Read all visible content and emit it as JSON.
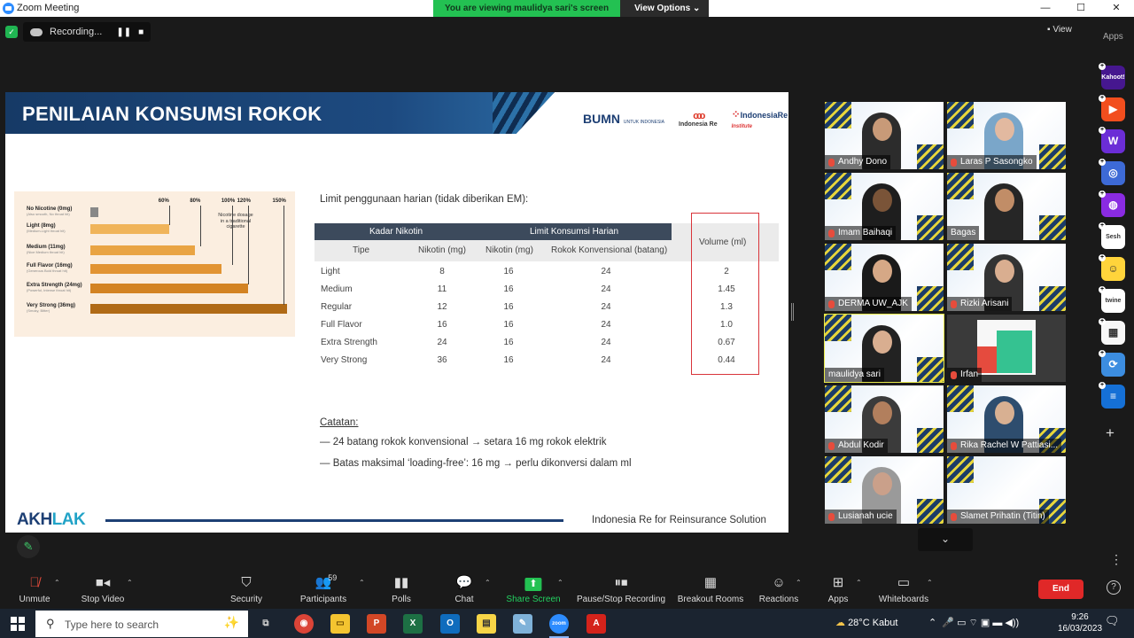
{
  "window": {
    "title": "Zoom Meeting",
    "share_banner": "You are viewing maulidya sari's screen",
    "view_options": "View Options",
    "min": "—",
    "max": "☐",
    "close": "✕"
  },
  "recording": {
    "label": "Recording...",
    "pause": "❚❚",
    "stop": "■"
  },
  "view_label": "View",
  "apps_label": "Apps",
  "slide": {
    "title": "PENILAIAN KONSUMSI ROKOK",
    "logos": {
      "bumn": "BUMN",
      "bumn_sub": "UNTUK INDONESIA",
      "re": "Indonesia Re",
      "re2": "IndonesiaRe",
      "re2_sub": "Institute"
    },
    "infographic": {
      "rows": [
        {
          "label": "No Nicotine (0mg)",
          "sub": "(Also smooth, No throat hit)",
          "pct": 0.03
        },
        {
          "label": "Light (8mg)",
          "sub": "(Medium-Light throat hit)",
          "pct": 0.6
        },
        {
          "label": "Medium (11mg)",
          "sub": "(Nice Medium throat hit)",
          "pct": 0.8
        },
        {
          "label": "Full Flavor (16mg)",
          "sub": "(Generous Bold throat hit)",
          "pct": 1.0
        },
        {
          "label": "Extra Strength (24mg)",
          "sub": "(Powerful, Intense throat hit)",
          "pct": 1.2
        },
        {
          "label": "Very Strong (36mg)",
          "sub": "(Smoky, Bitter)",
          "pct": 1.5
        }
      ],
      "ticks": [
        "60%",
        "80%",
        "100%",
        "120%",
        "150%"
      ],
      "note": "Nicotine dosage in a traditional cigarette"
    },
    "limit_text": "Limit penggunaan harian (tidak diberikan EM):",
    "table": {
      "group_kadar": "Kadar Nikotin",
      "group_limit": "Limit Konsumsi Harian",
      "volume_header": "Volume (ml)",
      "col_tipe": "Tipe",
      "col_nikotin": "Nikotin (mg)",
      "col_nikotin2": "Nikotin (mg)",
      "col_rokok": "Rokok Konvensional (batang)",
      "rows": [
        {
          "tipe": "Light",
          "nik": "8",
          "nik2": "16",
          "rokok": "24",
          "vol": "2"
        },
        {
          "tipe": "Medium",
          "nik": "11",
          "nik2": "16",
          "rokok": "24",
          "vol": "1.45"
        },
        {
          "tipe": "Regular",
          "nik": "12",
          "nik2": "16",
          "rokok": "24",
          "vol": "1.3"
        },
        {
          "tipe": "Full Flavor",
          "nik": "16",
          "nik2": "16",
          "rokok": "24",
          "vol": "1.0"
        },
        {
          "tipe": "Extra Strength",
          "nik": "24",
          "nik2": "16",
          "rokok": "24",
          "vol": "0.67"
        },
        {
          "tipe": "Very Strong",
          "nik": "36",
          "nik2": "16",
          "rokok": "24",
          "vol": "0.44"
        }
      ]
    },
    "notes_title": "Catatan:",
    "notes": [
      "— 24 batang rokok konvensional → setara 16 mg rokok elektrik",
      "— Batas maksimal ‘loading-free’: 16 mg → perlu dikonversi dalam ml"
    ],
    "akhlak_a": "AKH",
    "akhlak_b": "LAK",
    "footer": "Indonesia Re for Reinsurance Solution"
  },
  "participants_gallery": [
    {
      "name": "Andhy Dono",
      "muted": true,
      "skin": "#c89a78",
      "shirt": "#2c2c2c"
    },
    {
      "name": "Laras P Sasongko",
      "muted": true,
      "skin": "#e2b9a0",
      "shirt": "#7aa6c9"
    },
    {
      "name": "Imam Baihaqi",
      "muted": true,
      "skin": "#7a5438",
      "shirt": "#1e1e1e"
    },
    {
      "name": "Bagas",
      "muted": false,
      "skin": "#c18d67",
      "shirt": "#262626"
    },
    {
      "name": "DERMA UW_AJK",
      "muted": true,
      "skin": "#d6a886",
      "shirt": "#1a1a1a"
    },
    {
      "name": "Rizki Arisani",
      "muted": true,
      "skin": "#d9ae90",
      "shirt": "#333"
    },
    {
      "name": "maulidya sari",
      "muted": false,
      "skin": "#d9ae90",
      "shirt": "#222"
    },
    {
      "name": "Irfan",
      "muted": true,
      "skin": "",
      "shirt": ""
    },
    {
      "name": "Abdul Kodir",
      "muted": true,
      "skin": "#b27f5d",
      "shirt": "#3b3b3b"
    },
    {
      "name": "Rika Rachel W Pattiasi...",
      "muted": true,
      "skin": "#d8b092",
      "shirt": "#2e4d6e"
    },
    {
      "name": "Lusianah ucie",
      "muted": true,
      "skin": "#caa08a",
      "shirt": "#9a9a9a"
    },
    {
      "name": "Slamet Prihatin (Titin)",
      "muted": true,
      "skin": "",
      "shirt": ""
    }
  ],
  "side_apps": [
    {
      "label": "Kahoot!",
      "color": "#46178f"
    },
    {
      "label": "▶",
      "color": "#f24e1e"
    },
    {
      "label": "W",
      "color": "#6b2dd6"
    },
    {
      "label": "◎",
      "color": "#3d6ad6"
    },
    {
      "label": "◍",
      "color": "#8a2be2"
    },
    {
      "label": "Sesh",
      "color": "#ffffff"
    },
    {
      "label": "☺",
      "color": "#ffd43b"
    },
    {
      "label": "twine",
      "color": "#ffffff"
    },
    {
      "label": "▦",
      "color": "#f7f7f7"
    },
    {
      "label": "⟳",
      "color": "#3c8de0"
    },
    {
      "label": "≡",
      "color": "#1570d6"
    }
  ],
  "controls": {
    "unmute": "Unmute",
    "stop_video": "Stop Video",
    "security": "Security",
    "participants": "Participants",
    "participants_count": "59",
    "polls": "Polls",
    "chat": "Chat",
    "share": "Share Screen",
    "pause_rec": "Pause/Stop Recording",
    "breakout": "Breakout Rooms",
    "reactions": "Reactions",
    "apps": "Apps",
    "whiteboards": "Whiteboards",
    "end": "End"
  },
  "taskbar": {
    "search_placeholder": "Type here to search",
    "weather": "28°C  Kabut",
    "time": "9:26",
    "date": "16/03/2023"
  }
}
